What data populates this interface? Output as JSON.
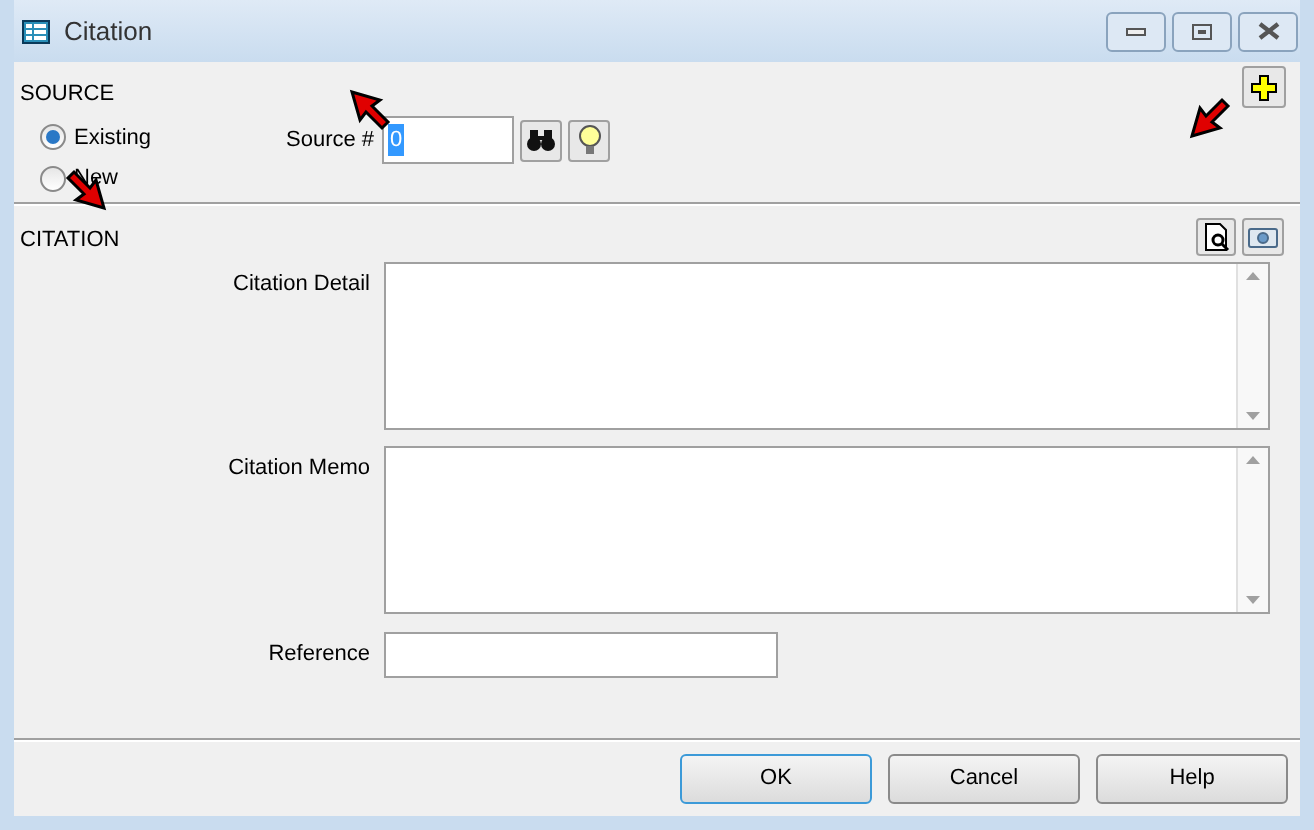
{
  "window": {
    "title": "Citation"
  },
  "source": {
    "heading": "SOURCE",
    "options": [
      {
        "label": "Existing",
        "selected": true
      },
      {
        "label": "New",
        "selected": false
      }
    ],
    "number_label": "Source #",
    "number_value": "0"
  },
  "citation": {
    "heading": "CITATION",
    "fields": [
      {
        "label": "Citation Detail",
        "kind": "memo"
      },
      {
        "label": "Citation Memo",
        "kind": "memo"
      },
      {
        "label": "Reference",
        "kind": "line"
      }
    ]
  },
  "buttons": [
    {
      "label": "OK",
      "default": true
    },
    {
      "label": "Cancel",
      "default": false
    },
    {
      "label": "Help",
      "default": false
    }
  ]
}
